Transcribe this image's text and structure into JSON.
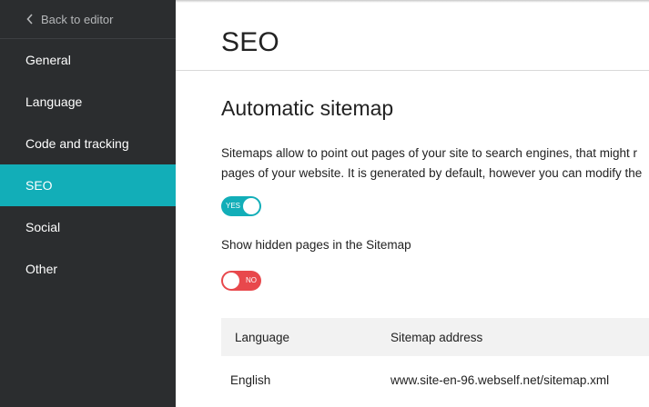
{
  "sidebar": {
    "back_label": "Back to editor",
    "items": [
      {
        "label": "General",
        "active": false
      },
      {
        "label": "Language",
        "active": false
      },
      {
        "label": "Code and tracking",
        "active": false
      },
      {
        "label": "SEO",
        "active": true
      },
      {
        "label": "Social",
        "active": false
      },
      {
        "label": "Other",
        "active": false
      }
    ]
  },
  "main": {
    "title": "SEO",
    "section_title": "Automatic sitemap",
    "description_line1": "Sitemaps allow to point out pages of your site to search engines, that might r",
    "description_line2": "pages of your website. It is generated by default, however you can modify the",
    "sitemap_toggle": {
      "state": "on",
      "label": "YES"
    },
    "hidden_pages_label": "Show hidden pages in the Sitemap",
    "hidden_pages_toggle": {
      "state": "off",
      "label": "NO"
    },
    "table": {
      "headers": [
        "Language",
        "Sitemap address"
      ],
      "rows": [
        [
          "English",
          "www.site-en-96.webself.net/sitemap.xml"
        ]
      ]
    }
  },
  "colors": {
    "sidebar_bg": "#2b2d2f",
    "accent": "#12aeb8",
    "toggle_off": "#e8484c"
  }
}
